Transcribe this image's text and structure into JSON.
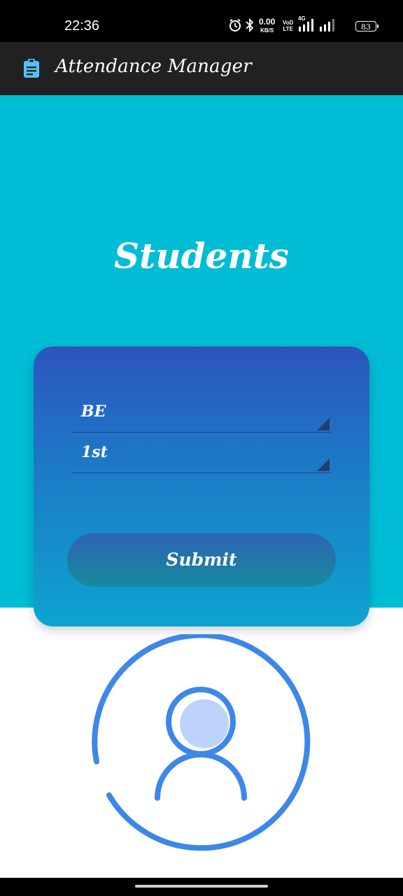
{
  "status_bar": {
    "time": "22:36",
    "net_speed": "0.00",
    "net_unit": "KB/S",
    "volte_top": "VoD",
    "volte_bottom": "LTE",
    "network_type": "4G",
    "battery": "83"
  },
  "app_bar": {
    "title": "Attendance Manager",
    "icon": "clipboard-icon"
  },
  "hero": {
    "title": "Students"
  },
  "form": {
    "course": "BE",
    "year": "1st",
    "submit_label": "Submit"
  },
  "colors": {
    "hero_bg": "#00bcd4",
    "app_bar_bg": "#212121",
    "card_top": "#2c55bd",
    "card_bottom": "#0da4d0",
    "avatar_stroke": "#3d87e8",
    "avatar_fill": "#bcd4fb"
  }
}
